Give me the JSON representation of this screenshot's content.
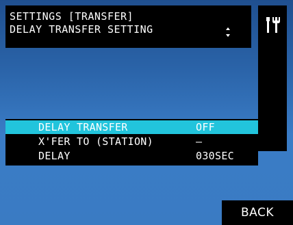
{
  "header": {
    "line1": "SETTINGS [TRANSFER]",
    "line2": "DELAY TRANSFER SETTING",
    "scroll_icon": "up-down-arrows-icon"
  },
  "sidebar": {
    "icon": "tools-icon"
  },
  "list": {
    "items": [
      {
        "label": "DELAY TRANSFER",
        "value": "OFF",
        "selected": true
      },
      {
        "label": "X'FER TO (STATION)",
        "value": "–",
        "selected": false
      },
      {
        "label": "DELAY",
        "value": "030SEC",
        "selected": false
      }
    ]
  },
  "footer": {
    "back_label": "BACK"
  },
  "colors": {
    "highlight": "#22c4dc",
    "panel": "#000000",
    "background_top": "#1f4f8f",
    "background_bottom": "#3a7bc3"
  }
}
